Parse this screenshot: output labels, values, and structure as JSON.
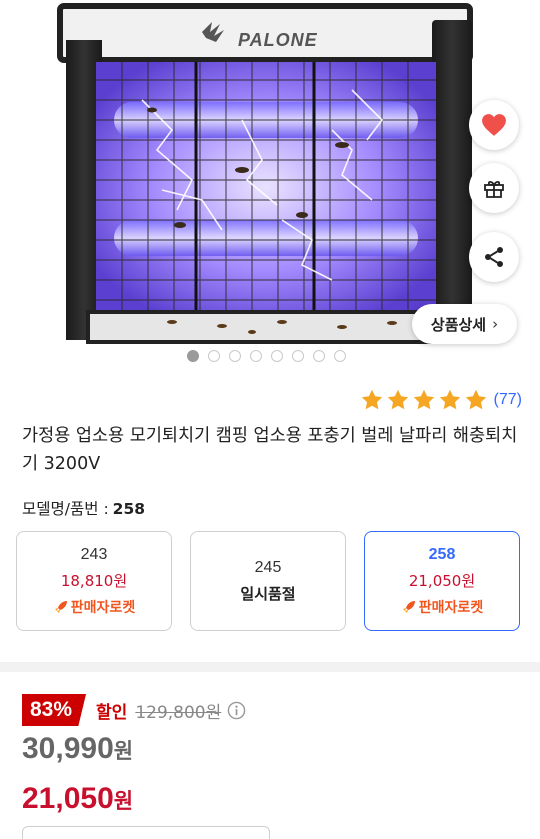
{
  "product_image": {
    "brand_logo_text": "PALONE",
    "slide_count": 8,
    "active_slide": 1
  },
  "actions": {
    "like_icon": "heart-icon",
    "gift_icon": "gift-icon",
    "share_icon": "share-icon",
    "detail_label": "상품상세",
    "detail_chevron": "›"
  },
  "rating": {
    "stars": 5,
    "count_text": "(77)",
    "star_color": "#f5a623"
  },
  "product": {
    "title": "가정용 업소용 모기퇴치기 캠핑 업소용 포충기 벌레 날파리 해충퇴치기 3200V",
    "model_label": "모델명/품번 :",
    "model_value": "258"
  },
  "options": [
    {
      "name": "243",
      "price": "18,810원",
      "badge": "판매자로켓",
      "selected": false
    },
    {
      "name": "245",
      "status": "일시품절",
      "selected": false
    },
    {
      "name": "258",
      "price": "21,050원",
      "badge": "판매자로켓",
      "selected": true
    }
  ],
  "price": {
    "discount_rate": "83%",
    "discount_label": "할인",
    "original_price": "129,800원",
    "sale_price": "30,990",
    "sale_unit": "원",
    "final_price": "21,050",
    "final_unit": "원"
  },
  "colors": {
    "accent_blue": "#346aff",
    "price_red": "#c8102e",
    "badge_red": "#cc0000",
    "rocket_orange": "#f0561e"
  }
}
